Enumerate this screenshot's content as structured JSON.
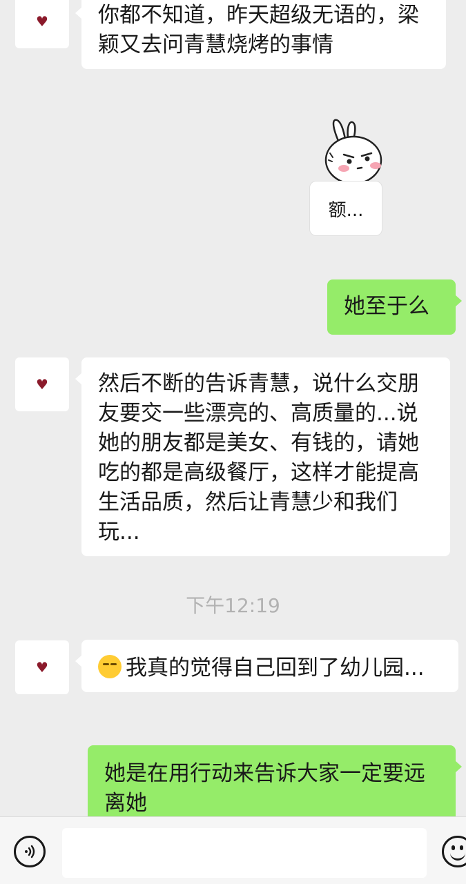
{
  "messages": [
    {
      "side": "left",
      "text": "你都不知道，昨天超级无语的，梁颖又去问青慧烧烤的事情"
    },
    {
      "side": "left",
      "type": "sticker",
      "caption": "额..."
    },
    {
      "side": "right",
      "text": "她至于么"
    },
    {
      "side": "left",
      "text": "然后不断的告诉青慧，说什么交朋友要交一些漂亮的、高质量的...说她的朋友都是美女、有钱的，请她吃的都是高级餐厅，这样才能提高生活品质，然后让青慧少和我们玩..."
    },
    {
      "side": "left",
      "emoji": "unamused-face",
      "text": "我真的觉得自己回到了幼儿园..."
    },
    {
      "side": "right",
      "text": "她是在用行动来告诉大家一定要远离她"
    }
  ],
  "timestamp": "下午12:19",
  "icons": {
    "avatar": "heart-icon",
    "voice": "voice-icon",
    "emoji_button": "smiley-icon"
  },
  "colors": {
    "background": "#ededed",
    "sent_bubble": "#95ec69",
    "received_bubble": "#ffffff",
    "heart": "#8b1a2b"
  }
}
